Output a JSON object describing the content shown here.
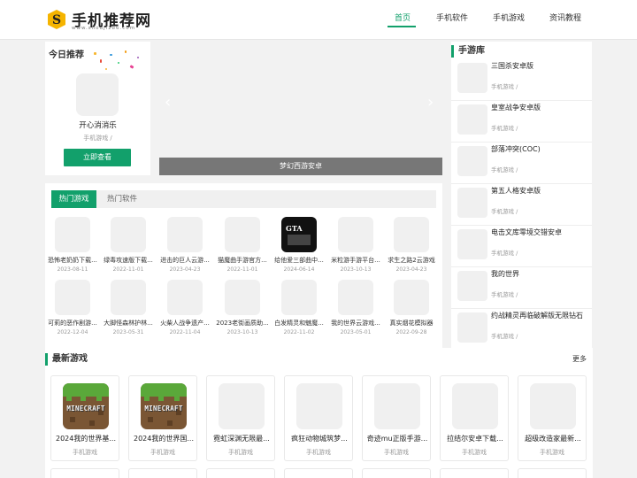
{
  "site": {
    "name": "手机推荐网",
    "domain": "www.shouji186.com"
  },
  "nav": [
    {
      "label": "首页",
      "active": true
    },
    {
      "label": "手机软件",
      "active": false
    },
    {
      "label": "手机游戏",
      "active": false
    },
    {
      "label": "资讯教程",
      "active": false
    }
  ],
  "today": {
    "title": "今日推荐",
    "name": "开心消消乐",
    "category": "手机游戏 /",
    "button": "立即查看"
  },
  "banner": {
    "caption": "梦幻西游安卓",
    "prev": "‹",
    "next": "›"
  },
  "hot": {
    "tabs": [
      "热门游戏",
      "热门软件"
    ],
    "items": [
      {
        "name": "恐怖老奶奶下载...",
        "date": "2023-08-11"
      },
      {
        "name": "绿毒攻速版下载...",
        "date": "2022-11-01"
      },
      {
        "name": "进击的巨人云游...",
        "date": "2023-04-23"
      },
      {
        "name": "猫魔曲手游官方...",
        "date": "2022-11-01"
      },
      {
        "name": "给他爱三部曲中...",
        "date": "2024-06-14"
      },
      {
        "name": "米粒游手游平台...",
        "date": "2023-10-13"
      },
      {
        "name": "求生之路2云游戏",
        "date": "2023-04-23"
      },
      {
        "name": "可莉的恶作剧游...",
        "date": "2022-12-04"
      },
      {
        "name": "大脚怪森林护林...",
        "date": "2023-05-31"
      },
      {
        "name": "火柴人战争遗产...",
        "date": "2022-11-04"
      },
      {
        "name": "2023老街画质助...",
        "date": "2023-10-13"
      },
      {
        "name": "白发精灵和魅魔...",
        "date": "2022-11-02"
      },
      {
        "name": "我的世界云游戏...",
        "date": "2023-05-01"
      },
      {
        "name": "真实烟花模拟器",
        "date": "2022-09-28"
      }
    ]
  },
  "library": {
    "title": "手游库",
    "items": [
      {
        "name": "三国杀安卓版",
        "category": "手机游戏 /"
      },
      {
        "name": "皇室战争安卓版",
        "category": "手机游戏 /"
      },
      {
        "name": "部落冲突(COC)",
        "category": "手机游戏 /"
      },
      {
        "name": "第五人格安卓版",
        "category": "手机游戏 /"
      },
      {
        "name": "电击文库零境交错安卓",
        "category": "手机游戏 /"
      },
      {
        "name": "我的世界",
        "category": "手机游戏 /"
      },
      {
        "name": "约战精灵再临破解版无限钻石",
        "category": "手机游戏 /"
      }
    ]
  },
  "newest": {
    "title": "最新游戏",
    "more": "更多",
    "items": [
      {
        "name": "2024我的世界基...",
        "category": "手机游戏"
      },
      {
        "name": "2024我的世界国...",
        "category": "手机游戏"
      },
      {
        "name": "霓虹深渊无限最...",
        "category": "手机游戏"
      },
      {
        "name": "疯狂动物城筑梦...",
        "category": "手机游戏"
      },
      {
        "name": "奇迹mu正版手游...",
        "category": "手机游戏"
      },
      {
        "name": "拉结尔安卓下载...",
        "category": "手机游戏"
      },
      {
        "name": "超级改造家最新...",
        "category": "手机游戏"
      }
    ]
  },
  "icons": {
    "minecraft_label": "MINECRAFT",
    "gta_label": "GTA"
  },
  "colors": {
    "accent": "#12a06b",
    "banner_caption_bg": "#777777"
  }
}
